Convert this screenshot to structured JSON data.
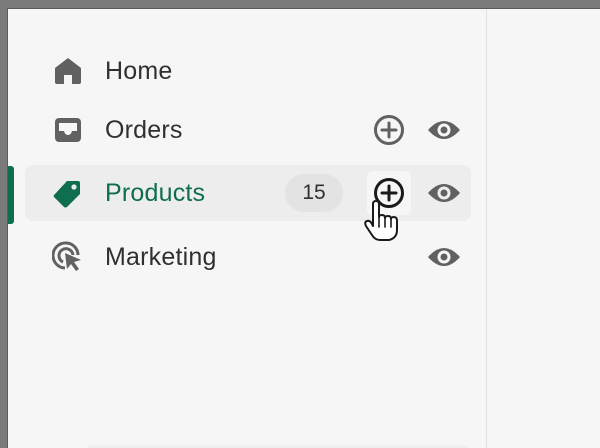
{
  "nav": {
    "items": [
      {
        "label": "Home",
        "icon": "home-icon"
      },
      {
        "label": "Orders",
        "icon": "inbox-icon",
        "actions": [
          "add-icon",
          "eye-icon"
        ]
      },
      {
        "label": "Products",
        "icon": "tag-icon",
        "badge": "15",
        "selected": true,
        "actions": [
          "add-icon",
          "eye-icon"
        ]
      },
      {
        "label": "Marketing",
        "icon": "target-icon",
        "actions": [
          "eye-icon"
        ]
      }
    ]
  },
  "colors": {
    "accent": "#0f6e50",
    "icon": "#616161",
    "text": "#303030",
    "selected_background": "#ededed",
    "badge_background": "#e3e3e3"
  }
}
